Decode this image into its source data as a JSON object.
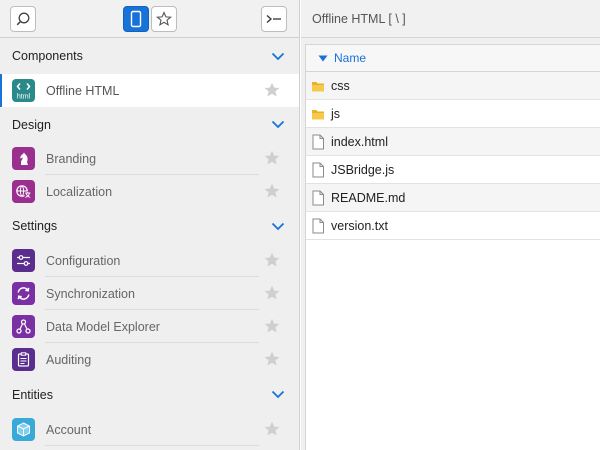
{
  "main": {
    "title": "Offline HTML [ \\ ]"
  },
  "file_browser": {
    "column_name": "Name",
    "files": [
      {
        "name": "css",
        "type": "folder"
      },
      {
        "name": "js",
        "type": "folder"
      },
      {
        "name": "index.html",
        "type": "file"
      },
      {
        "name": "JSBridge.js",
        "type": "file"
      },
      {
        "name": "README.md",
        "type": "file"
      },
      {
        "name": "version.txt",
        "type": "file"
      }
    ]
  },
  "sidebar": {
    "sections": [
      {
        "title": "Components",
        "items": [
          {
            "label": "Offline HTML",
            "icon": "html-icon",
            "color": "#2a8a8a",
            "active": true
          }
        ]
      },
      {
        "title": "Design",
        "items": [
          {
            "label": "Branding",
            "icon": "chess-knight-icon",
            "color": "#9b2f8f"
          },
          {
            "label": "Localization",
            "icon": "globe-translate-icon",
            "color": "#9b2f8f"
          }
        ]
      },
      {
        "title": "Settings",
        "items": [
          {
            "label": "Configuration",
            "icon": "sliders-icon",
            "color": "#5b2d8e"
          },
          {
            "label": "Synchronization",
            "icon": "sync-icon",
            "color": "#7a2fa3"
          },
          {
            "label": "Data Model Explorer",
            "icon": "graph-icon",
            "color": "#7a2fa3"
          },
          {
            "label": "Auditing",
            "icon": "clipboard-icon",
            "color": "#5b2d8e"
          }
        ]
      },
      {
        "title": "Entities",
        "items": [
          {
            "label": "Account",
            "icon": "cube-icon",
            "color": "#39a9d8"
          }
        ]
      }
    ]
  },
  "colors": {
    "accent": "#1872d8",
    "star": "#cfcfcf"
  },
  "icon_labels": {
    "html": "html"
  }
}
